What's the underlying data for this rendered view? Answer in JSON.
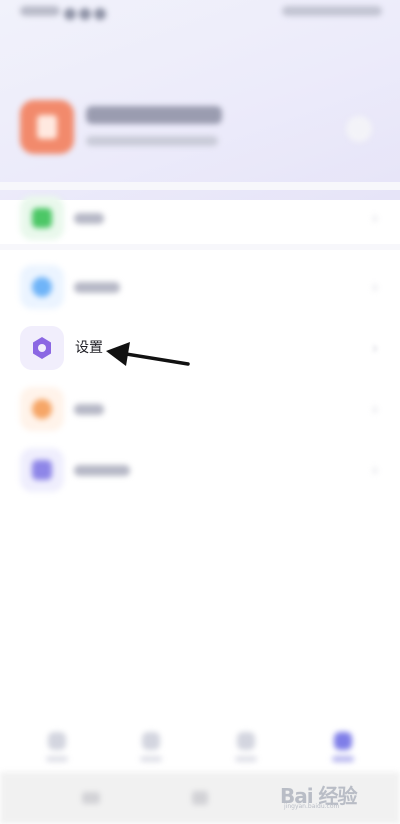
{
  "list": {
    "settings_label": "设置"
  },
  "icons": {
    "settings_icon": "hexagon-icon",
    "chevron": "chevron-right-icon"
  },
  "watermark": {
    "text": "Bai 经验",
    "sub": "jingyan.baidu.com"
  },
  "colors": {
    "accent": "#8b67e3",
    "avatar": "#f28a6c",
    "row_green": "#4cc766",
    "row_blue": "#6fb4f8",
    "row_orange": "#f6a667",
    "row_purple": "#8e86e8"
  }
}
